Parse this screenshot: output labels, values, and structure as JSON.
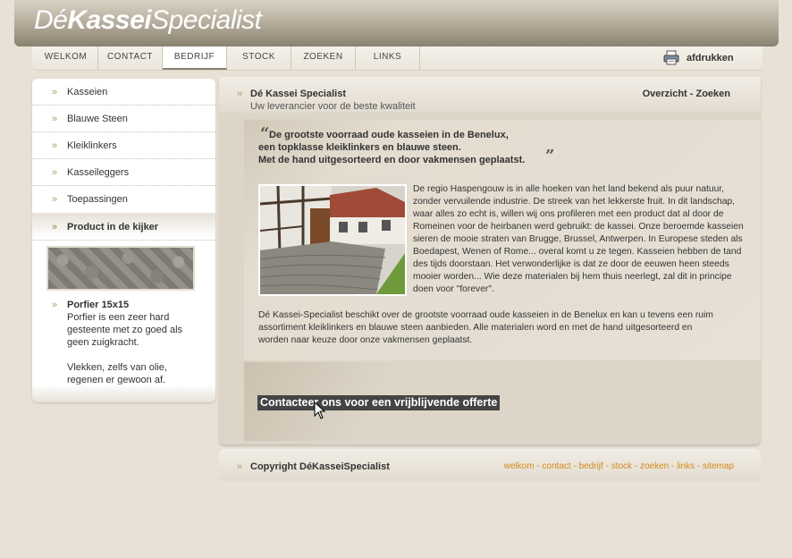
{
  "header": {
    "logo_part1": "Dé",
    "logo_part2": "Kassei",
    "logo_part3": "Specialist"
  },
  "nav": {
    "tabs": [
      {
        "label": "WELKOM"
      },
      {
        "label": "CONTACT"
      },
      {
        "label": "BEDRIJF",
        "active": true
      },
      {
        "label": "STOCK"
      },
      {
        "label": "ZOEKEN"
      },
      {
        "label": "LINKS"
      }
    ],
    "print_label": "afdrukken",
    "print_icon": "printer-icon"
  },
  "sidebar": {
    "items": [
      {
        "label": "Kasseien"
      },
      {
        "label": "Blauwe Steen"
      },
      {
        "label": "Kleiklinkers"
      },
      {
        "label": "Kasseileggers"
      },
      {
        "label": "Toepassingen"
      }
    ],
    "arrow": "»",
    "kijker_title": "Product in de kijker",
    "product_name": "Porfier 15x15",
    "product_desc1": "Porfier is een zeer hard gesteente met zo goed als geen zuigkracht.",
    "product_desc2": "Vlekken, zelfs van olie, regenen er gewoon af."
  },
  "main": {
    "title": "Dé Kassei Specialist",
    "subtitle": "Uw leverancier voor de beste kwaliteit",
    "links": "Overzicht - Zoeken",
    "quote_open": "“",
    "quote_close": "”",
    "quote_line1": "De grootste voorraad oude kasseien in de Benelux,",
    "quote_line2": "een topklasse kleiklinkers en blauwe steen.",
    "quote_line3": "Met de hand uitgesorteerd en door vakmensen geplaatst.",
    "para1": "De regio Haspengouw is in alle hoeken van het land bekend als puur natuur, zonder vervuilende industrie. De streek van het lekkerste fruit. In dit landschap, waar alles zo echt is, willen wij ons profileren met een  product dat al door de Romeinen voor de heirbanen werd gebruikt: de kassei. Onze beroemde kasseien sieren de mooie straten van Brugge, Brussel, Antwerpen. In Europese steden als Boedapest, Wenen of Rome... overal komt u ze tegen. Kasseien hebben de tand des tijds doorstaan. Het verwonderlijke is dat ze door de eeuwen heen steeds mooier worden... Wie deze materialen bij hem thuis neerlegt, zal dit in principe doen voor \"forever\".",
    "para2": "Dé Kassei-Specialist beschikt over de grootste voorraad oude kasseien in de Benelux en kan u tevens  een ruim assortiment kleiklinkers en blauwe steen aanbieden. Alle materialen word en met de hand uitgesorteerd en worden naar keuze door onze vakmensen geplaatst.",
    "cta": "Contacteer ons voor een vrijblijvende offerte"
  },
  "footer": {
    "copyright": "Copyright DéKasseiSpecialist",
    "links": [
      "welkom",
      "contact",
      "bedrijf",
      "stock",
      "zoeken",
      "links",
      "sitemap"
    ],
    "separator": " - ",
    "link_color": "#d48a1a"
  }
}
